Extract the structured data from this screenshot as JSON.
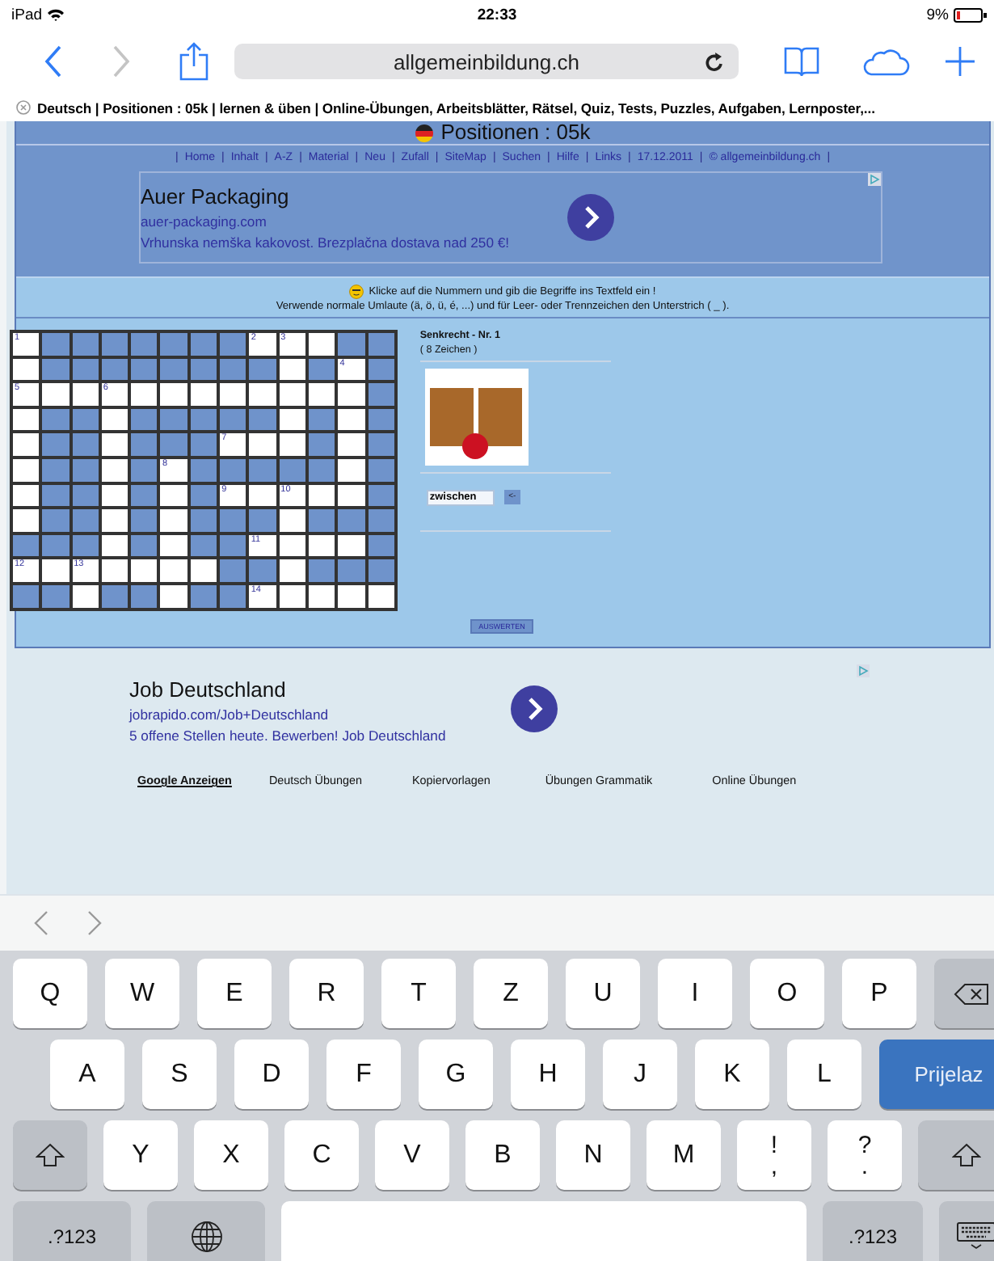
{
  "status_bar": {
    "device": "iPad",
    "time": "22:33",
    "battery": "9%"
  },
  "browser": {
    "back_disabled": false,
    "forward_disabled": true,
    "url": "allgemeinbildung.ch",
    "tab_title": "Deutsch | Positionen : 05k | lernen & üben | Online-Übungen, Arbeitsblätter, Rätsel, Quiz, Tests, Puzzles, Aufgaben, Lernposter,..."
  },
  "page": {
    "heading": "Positionen : 05k",
    "nav": {
      "separator": "|",
      "links": [
        "Home",
        "Inhalt",
        "A-Z",
        "Material",
        "Neu",
        "Zufall",
        "SiteMap",
        "Suchen",
        "Hilfe",
        "Links",
        "17.12.2011",
        "© allgemeinbildung.ch"
      ]
    },
    "ads": [
      {
        "title": "Auer Packaging",
        "url": "auer-packaging.com",
        "text": "Vrhunska nemška kakovost. Brezplačna dostava nad 250 €!"
      },
      {
        "title": "Job Deutschland",
        "url": "jobrapido.com/Job+Deutschland",
        "text": "5 offene Stellen heute. Bewerben! Job Deutschland"
      }
    ],
    "instructions": [
      "Klicke auf die Nummern und gib die Begriffe ins Textfeld ein !",
      "Verwende normale Umlaute (ä, ö, ü, é, ...) und für Leer- oder Trennzeichen den Unterstrich ( _ )."
    ],
    "crossword": {
      "rows": [
        [
          {
            "open": true,
            "number": "1"
          },
          {
            "open": false
          },
          {
            "open": false
          },
          {
            "open": false
          },
          {
            "open": false
          },
          {
            "open": false
          },
          {
            "open": false
          },
          {
            "open": false
          },
          {
            "open": true,
            "number": "2"
          },
          {
            "open": true,
            "number": "3"
          },
          {
            "open": true
          },
          {
            "open": false
          },
          {
            "open": false
          }
        ],
        [
          {
            "open": true
          },
          {
            "open": false
          },
          {
            "open": false
          },
          {
            "open": false
          },
          {
            "open": false
          },
          {
            "open": false
          },
          {
            "open": false
          },
          {
            "open": false
          },
          {
            "open": false
          },
          {
            "open": true
          },
          {
            "open": false
          },
          {
            "open": true,
            "number": "4"
          },
          {
            "open": false
          }
        ],
        [
          {
            "open": true,
            "number": "5"
          },
          {
            "open": true
          },
          {
            "open": true
          },
          {
            "open": true,
            "number": "6"
          },
          {
            "open": true
          },
          {
            "open": true
          },
          {
            "open": true
          },
          {
            "open": true
          },
          {
            "open": true
          },
          {
            "open": true
          },
          {
            "open": true
          },
          {
            "open": true
          },
          {
            "open": false
          }
        ],
        [
          {
            "open": true
          },
          {
            "open": false
          },
          {
            "open": false
          },
          {
            "open": true
          },
          {
            "open": false
          },
          {
            "open": false
          },
          {
            "open": false
          },
          {
            "open": false
          },
          {
            "open": false
          },
          {
            "open": true
          },
          {
            "open": false
          },
          {
            "open": true
          },
          {
            "open": false
          }
        ],
        [
          {
            "open": true
          },
          {
            "open": false
          },
          {
            "open": false
          },
          {
            "open": true
          },
          {
            "open": false
          },
          {
            "open": false
          },
          {
            "open": false
          },
          {
            "open": true,
            "number": "7"
          },
          {
            "open": true
          },
          {
            "open": true
          },
          {
            "open": false
          },
          {
            "open": true
          },
          {
            "open": false
          }
        ],
        [
          {
            "open": true
          },
          {
            "open": false
          },
          {
            "open": false
          },
          {
            "open": true
          },
          {
            "open": false
          },
          {
            "open": true,
            "number": "8"
          },
          {
            "open": false
          },
          {
            "open": false
          },
          {
            "open": false
          },
          {
            "open": false
          },
          {
            "open": false
          },
          {
            "open": true
          },
          {
            "open": false
          }
        ],
        [
          {
            "open": true
          },
          {
            "open": false
          },
          {
            "open": false
          },
          {
            "open": true
          },
          {
            "open": false
          },
          {
            "open": true
          },
          {
            "open": false
          },
          {
            "open": true,
            "number": "9"
          },
          {
            "open": true
          },
          {
            "open": true,
            "number": "10"
          },
          {
            "open": true
          },
          {
            "open": true
          },
          {
            "open": false
          }
        ],
        [
          {
            "open": true
          },
          {
            "open": false
          },
          {
            "open": false
          },
          {
            "open": true
          },
          {
            "open": false
          },
          {
            "open": true
          },
          {
            "open": false
          },
          {
            "open": false
          },
          {
            "open": false
          },
          {
            "open": true
          },
          {
            "open": false
          },
          {
            "open": false
          },
          {
            "open": false
          }
        ],
        [
          {
            "open": false
          },
          {
            "open": false
          },
          {
            "open": false
          },
          {
            "open": true
          },
          {
            "open": false
          },
          {
            "open": true
          },
          {
            "open": false
          },
          {
            "open": false
          },
          {
            "open": true,
            "number": "11"
          },
          {
            "open": true
          },
          {
            "open": true
          },
          {
            "open": true
          },
          {
            "open": false
          }
        ],
        [
          {
            "open": true,
            "number": "12"
          },
          {
            "open": true
          },
          {
            "open": true,
            "number": "13"
          },
          {
            "open": true
          },
          {
            "open": true
          },
          {
            "open": true
          },
          {
            "open": true
          },
          {
            "open": false
          },
          {
            "open": false
          },
          {
            "open": true
          },
          {
            "open": false
          },
          {
            "open": false
          },
          {
            "open": false
          }
        ],
        [
          {
            "open": false
          },
          {
            "open": false
          },
          {
            "open": true
          },
          {
            "open": false
          },
          {
            "open": false
          },
          {
            "open": true
          },
          {
            "open": false
          },
          {
            "open": false
          },
          {
            "open": true,
            "number": "14"
          },
          {
            "open": true
          },
          {
            "open": true
          },
          {
            "open": true
          },
          {
            "open": true
          }
        ]
      ],
      "clue_title": "Senkrecht - Nr. 1",
      "clue_length": "( 8 Zeichen )",
      "answer": "zwischen",
      "enter_button": "<-",
      "evaluate_button": "AUSWERTEN"
    },
    "footer_links": [
      {
        "label": "Google Anzeigen",
        "kind": "title"
      },
      {
        "label": "Deutsch Übungen",
        "kind": "link"
      },
      {
        "label": "Kopiervorlagen",
        "kind": "link"
      },
      {
        "label": "Übungen Grammatik",
        "kind": "link"
      },
      {
        "label": "Online Übungen",
        "kind": "link"
      }
    ]
  },
  "keyboard": {
    "top_keys": [
      {
        "kind": "letter",
        "label": "Q"
      },
      {
        "kind": "letter",
        "label": "W"
      },
      {
        "kind": "letter",
        "label": "E"
      },
      {
        "kind": "letter",
        "label": "R"
      },
      {
        "kind": "letter",
        "label": "T"
      },
      {
        "kind": "letter",
        "label": "Z"
      },
      {
        "kind": "letter",
        "label": "U"
      },
      {
        "kind": "letter",
        "label": "I"
      },
      {
        "kind": "letter",
        "label": "O"
      },
      {
        "kind": "letter",
        "label": "P"
      },
      {
        "kind": "delete"
      }
    ],
    "home_keys": [
      {
        "kind": "letter",
        "label": "A"
      },
      {
        "kind": "letter",
        "label": "S"
      },
      {
        "kind": "letter",
        "label": "D"
      },
      {
        "kind": "letter",
        "label": "F"
      },
      {
        "kind": "letter",
        "label": "G"
      },
      {
        "kind": "letter",
        "label": "H"
      },
      {
        "kind": "letter",
        "label": "J"
      },
      {
        "kind": "letter",
        "label": "K"
      },
      {
        "kind": "letter",
        "label": "L"
      },
      {
        "kind": "return",
        "label": "Prijelaz"
      }
    ],
    "lower_keys": [
      {
        "kind": "shift"
      },
      {
        "kind": "letter",
        "label": "Y"
      },
      {
        "kind": "letter",
        "label": "X"
      },
      {
        "kind": "letter",
        "label": "C"
      },
      {
        "kind": "letter",
        "label": "V"
      },
      {
        "kind": "letter",
        "label": "B"
      },
      {
        "kind": "letter",
        "label": "N"
      },
      {
        "kind": "letter",
        "label": "M"
      },
      {
        "kind": "dual",
        "label": "!",
        "label2": ","
      },
      {
        "kind": "dual",
        "label": "?",
        "label2": "."
      },
      {
        "kind": "shift"
      }
    ],
    "function_keys": [
      {
        "kind": "mode",
        "label": ".?123"
      },
      {
        "kind": "globe"
      },
      {
        "kind": "space"
      },
      {
        "kind": "mode",
        "label": ".?123"
      },
      {
        "kind": "dismiss"
      }
    ]
  }
}
